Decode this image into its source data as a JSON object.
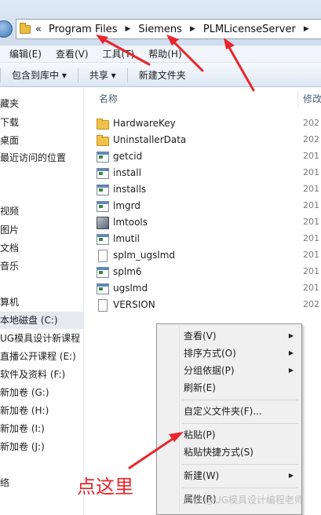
{
  "address_bar": {
    "overflow": "«",
    "segments": [
      "Program Files",
      "Siemens",
      "PLMLicenseServer"
    ],
    "separator": "▶"
  },
  "menu_bar": {
    "items": [
      "编辑(E)",
      "查看(V)",
      "工具(T)",
      "帮助(H)"
    ]
  },
  "toolbar": {
    "items": [
      "包含到库中 ▾",
      "共享 ▾",
      "新建文件夹"
    ]
  },
  "nav_pane": {
    "items": [
      "藏夹",
      "下载",
      "桌面",
      "最近访问的位置",
      "",
      "视频",
      "图片",
      "文档",
      "音乐",
      "算机",
      "本地磁盘 (C:)",
      "UG模具设计新课程",
      "直播公开课程 (E:)",
      "软件及资料 (F:)",
      "新加卷 (G:)",
      "新加卷 (H:)",
      "新加卷 (I:)",
      "新加卷 (J:)",
      "络"
    ]
  },
  "file_list": {
    "columns": {
      "name": "名称",
      "modified": "修改"
    },
    "rows": [
      {
        "name": "HardwareKey",
        "icon": "folder-icon",
        "date": "202"
      },
      {
        "name": "UninstallerData",
        "icon": "folder-icon",
        "date": "202"
      },
      {
        "name": "getcid",
        "icon": "exe-icon",
        "date": "201"
      },
      {
        "name": "install",
        "icon": "exe-icon",
        "date": "201"
      },
      {
        "name": "installs",
        "icon": "exe-icon",
        "date": "201"
      },
      {
        "name": "lmgrd",
        "icon": "exe-icon",
        "date": "201"
      },
      {
        "name": "lmtools",
        "icon": "tool-icon",
        "date": "201"
      },
      {
        "name": "lmutil",
        "icon": "exe-icon",
        "date": "201"
      },
      {
        "name": "splm_ugslmd",
        "icon": "document-icon",
        "date": "201"
      },
      {
        "name": "splm6",
        "icon": "exe-icon",
        "date": "201"
      },
      {
        "name": "ugslmd",
        "icon": "exe-icon",
        "date": "201"
      },
      {
        "name": "VERSION",
        "icon": "document-icon",
        "date": "202"
      }
    ]
  },
  "context_menu": {
    "items": [
      "查看(V)",
      "排序方式(O)",
      "分组依据(P)",
      "刷新(E)",
      "自定义文件夹(F)...",
      "粘贴(P)",
      "粘贴快捷方式(S)",
      "新建(W)",
      "属性(R)"
    ]
  },
  "annotations": {
    "callout": "点这里",
    "watermark": "头条 @UG模具设计编程老师",
    "arrow_color": "#e8262c"
  }
}
